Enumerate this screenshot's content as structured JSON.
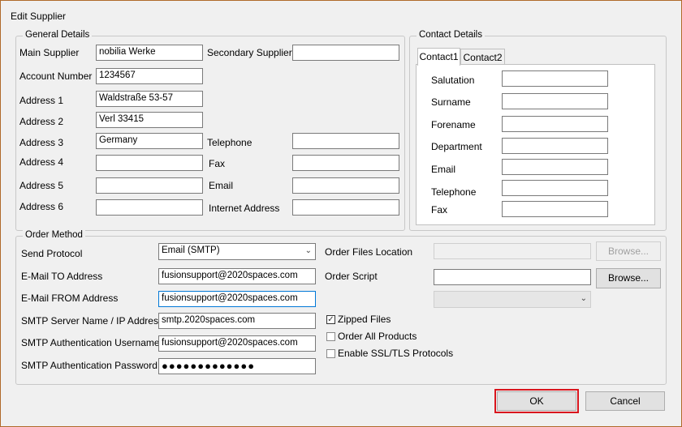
{
  "window": {
    "title": "Edit Supplier"
  },
  "general": {
    "legend": "General Details",
    "main_supplier_label": "Main Supplier",
    "main_supplier": "nobilia Werke",
    "secondary_supplier_label": "Secondary Supplier",
    "secondary_supplier": "",
    "account_number_label": "Account Number",
    "account_number": "1234567",
    "address1_label": "Address 1",
    "address1": "Waldstraße 53-57",
    "address2_label": "Address 2",
    "address2": "Verl 33415",
    "address3_label": "Address 3",
    "address3": "Germany",
    "address4_label": "Address 4",
    "address4": "",
    "address5_label": "Address 5",
    "address5": "",
    "address6_label": "Address 6",
    "address6": "",
    "telephone_label": "Telephone",
    "telephone": "",
    "fax_label": "Fax",
    "fax": "",
    "email_label": "Email",
    "email": "",
    "internet_label": "Internet Address",
    "internet": ""
  },
  "contact": {
    "legend": "Contact Details",
    "tabs": [
      "Contact1",
      "Contact2"
    ],
    "salutation_label": "Salutation",
    "surname_label": "Surname",
    "forename_label": "Forename",
    "department_label": "Department",
    "email_label": "Email",
    "telephone_label": "Telephone",
    "fax_label": "Fax"
  },
  "order": {
    "legend": "Order Method",
    "send_protocol_label": "Send Protocol",
    "send_protocol": "Email (SMTP)",
    "email_to_label": "E-Mail TO Address",
    "email_to": "fusionsupport@2020spaces.com",
    "email_from_label": "E-Mail FROM Address",
    "email_from": "fusionsupport@2020spaces.com",
    "smtp_server_label": "SMTP Server Name / IP Address",
    "smtp_server": "smtp.2020spaces.com",
    "smtp_user_label": "SMTP Authentication Username",
    "smtp_user": "fusionsupport@2020spaces.com",
    "smtp_pass_label": "SMTP Authentication Password",
    "smtp_pass": "●●●●●●●●●●●●●",
    "files_location_label": "Order Files Location",
    "browse_label": "Browse...",
    "script_label": "Order Script",
    "zipped_label": "Zipped Files",
    "zipped_checked": true,
    "all_products_label": "Order All Products",
    "ssl_label": "Enable SSL/TLS Protocols"
  },
  "buttons": {
    "ok": "OK",
    "cancel": "Cancel"
  },
  "colors": {
    "highlight": "#d9161e",
    "focus": "#0078d7"
  }
}
